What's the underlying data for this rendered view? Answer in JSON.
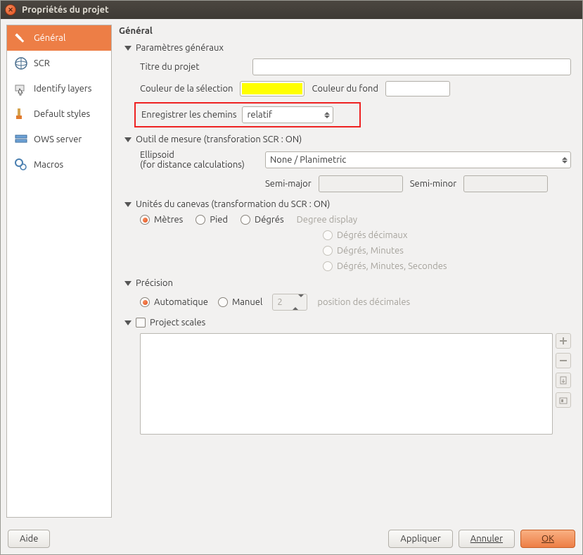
{
  "window": {
    "title": "Propriétés du projet"
  },
  "sidebar": {
    "items": [
      {
        "label": "Général"
      },
      {
        "label": "SCR"
      },
      {
        "label": "Identify layers"
      },
      {
        "label": "Default styles"
      },
      {
        "label": "OWS server"
      },
      {
        "label": "Macros"
      }
    ]
  },
  "page": {
    "title": "Général",
    "sec_general": "Paramètres généraux",
    "lbl_title": "Titre du projet",
    "val_title": "",
    "lbl_sel_color": "Couleur de la sélection",
    "lbl_bg_color": "Couleur du fond",
    "lbl_save_paths": "Enregistrer les chemins",
    "val_save_paths": "relatif",
    "sec_measure": "Outil de mesure (transforation SCR : ON)",
    "lbl_ellipsoid_1": "Ellipsoid",
    "lbl_ellipsoid_2": "(for distance calculations)",
    "val_ellipsoid": "None / Planimetric",
    "lbl_semi_major": "Semi-major",
    "val_semi_major": "",
    "lbl_semi_minor": "Semi-minor",
    "val_semi_minor": "",
    "sec_units": "Unités du canevas (transformation du SCR : ON)",
    "unit_m": "Mètres",
    "unit_ft": "Pied",
    "unit_deg": "Dégrés",
    "lbl_deg_display": "Degree display",
    "deg_dec": "Dégrés décimaux",
    "deg_dm": "Dégrés, Minutes",
    "deg_dms": "Dégrés, Minutes, Secondes",
    "sec_precision": "Précision",
    "prec_auto": "Automatique",
    "prec_manual": "Manuel",
    "prec_val": "2",
    "prec_suffix": "position des décimales",
    "sec_scales": "Project scales"
  },
  "footer": {
    "help": "Aide",
    "apply": "Appliquer",
    "cancel": "Annuler",
    "ok": "OK"
  }
}
